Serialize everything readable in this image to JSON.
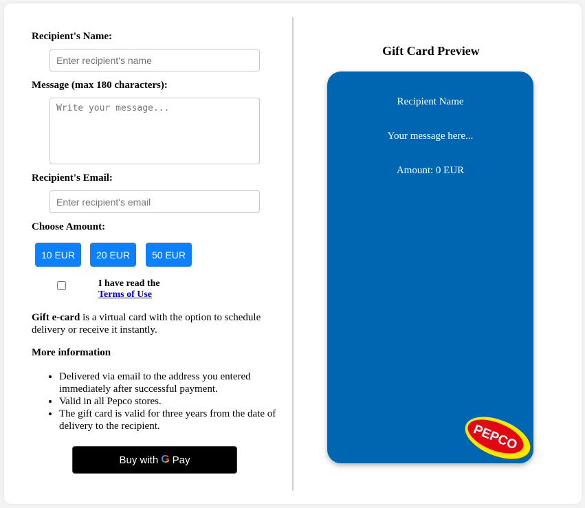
{
  "form": {
    "name_label": "Recipient's Name:",
    "name_placeholder": "Enter recipient's name",
    "message_label": "Message (max 180 characters):",
    "message_placeholder": "Write your message...",
    "email_label": "Recipient's Email:",
    "email_placeholder": "Enter recipient's email",
    "amount_label": "Choose Amount:",
    "amounts": [
      "10 EUR",
      "20 EUR",
      "50 EUR"
    ],
    "terms_text": "I have read the",
    "terms_link": "Terms of Use"
  },
  "info": {
    "desc_bold": "Gift e-card",
    "desc_rest": " is a virtual card with the option to schedule delivery or receive it instantly.",
    "more_title": "More information",
    "items": [
      "Delivered via email to the address you entered immediately after successful payment.",
      "Valid in all Pepco stores.",
      "The gift card is valid for three years from the date of delivery to the recipient."
    ]
  },
  "payment": {
    "buy_with": "Buy with",
    "g": "G",
    "pay": "Pay"
  },
  "preview": {
    "title": "Gift Card Preview",
    "recipient": "Recipient Name",
    "message": "Your message here...",
    "amount": "Amount: 0 EUR",
    "card_color": "#0066b2",
    "logo_text": "PEPCO"
  },
  "colors": {
    "accent": "#0d80ff",
    "logo_red": "#e30613",
    "logo_yellow": "#ffe600"
  }
}
